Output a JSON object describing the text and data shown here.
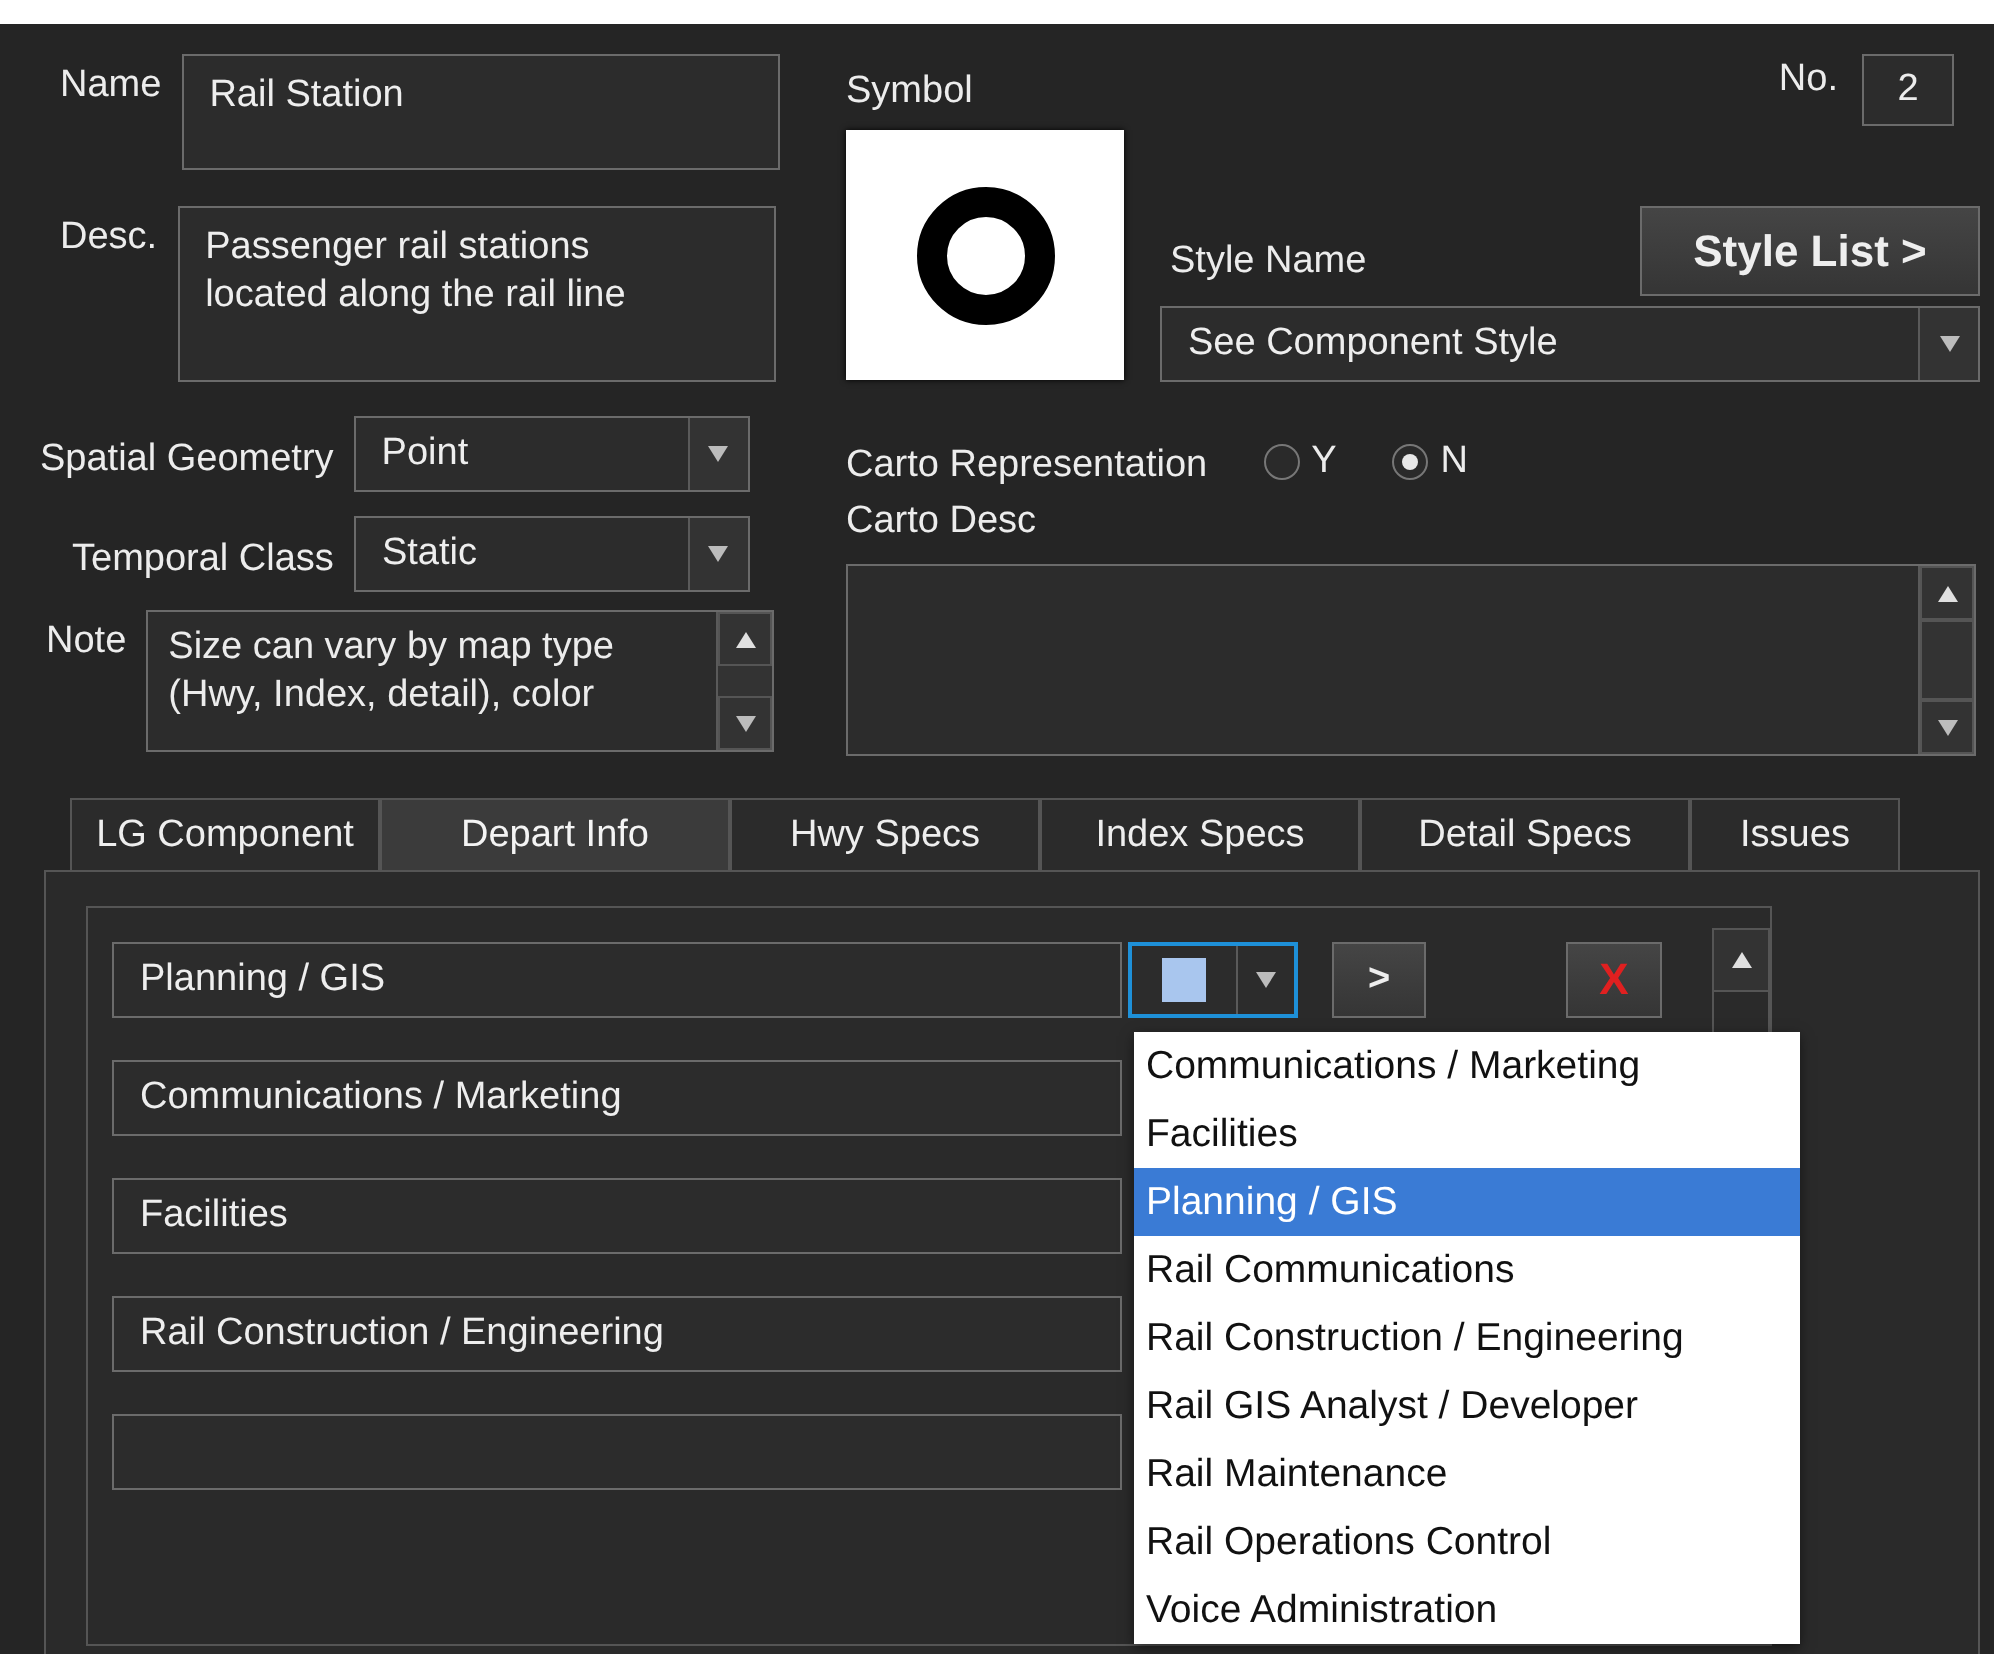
{
  "name": {
    "label": "Name",
    "value": "Rail Station"
  },
  "desc": {
    "label": "Desc.",
    "lines": [
      "Passenger rail stations",
      "located along the rail line"
    ]
  },
  "spatial_geometry": {
    "label": "Spatial Geometry",
    "value": "Point"
  },
  "temporal_class": {
    "label": "Temporal Class",
    "value": "Static"
  },
  "note": {
    "label": "Note",
    "lines": [
      "Size can vary by map type",
      "(Hwy, Index, detail), color"
    ]
  },
  "symbol": {
    "label": "Symbol"
  },
  "number": {
    "label": "No.",
    "value": "2"
  },
  "style_list_button": "Style List >",
  "style_name": {
    "label": "Style Name",
    "value": "See Component Style"
  },
  "carto_representation": {
    "label": "Carto Representation",
    "options": [
      {
        "label": "Y",
        "selected": false
      },
      {
        "label": "N",
        "selected": true
      }
    ]
  },
  "carto_desc": {
    "label": "Carto Desc"
  },
  "tabs": [
    {
      "label": "LG Component",
      "selected": false
    },
    {
      "label": "Depart Info",
      "selected": true
    },
    {
      "label": "Hwy Specs",
      "selected": false
    },
    {
      "label": "Index Specs",
      "selected": false
    },
    {
      "label": "Detail Specs",
      "selected": false
    },
    {
      "label": "Issues",
      "selected": false
    }
  ],
  "departments": [
    {
      "value": "Planning / GIS"
    },
    {
      "value": "Communications / Marketing"
    },
    {
      "value": "Facilities"
    },
    {
      "value": "Rail Construction / Engineering"
    }
  ],
  "row_controls": {
    "next_button": ">",
    "delete_button": "X"
  },
  "department_menu": [
    {
      "label": "Communications / Marketing",
      "selected": false
    },
    {
      "label": "Facilities",
      "selected": false
    },
    {
      "label": "Planning / GIS",
      "selected": true
    },
    {
      "label": "Rail Communications",
      "selected": false
    },
    {
      "label": "Rail Construction / Engineering",
      "selected": false
    },
    {
      "label": "Rail GIS Analyst / Developer",
      "selected": false
    },
    {
      "label": "Rail Maintenance",
      "selected": false
    },
    {
      "label": "Rail Operations Control",
      "selected": false
    },
    {
      "label": "Voice Administration",
      "selected": false
    }
  ]
}
